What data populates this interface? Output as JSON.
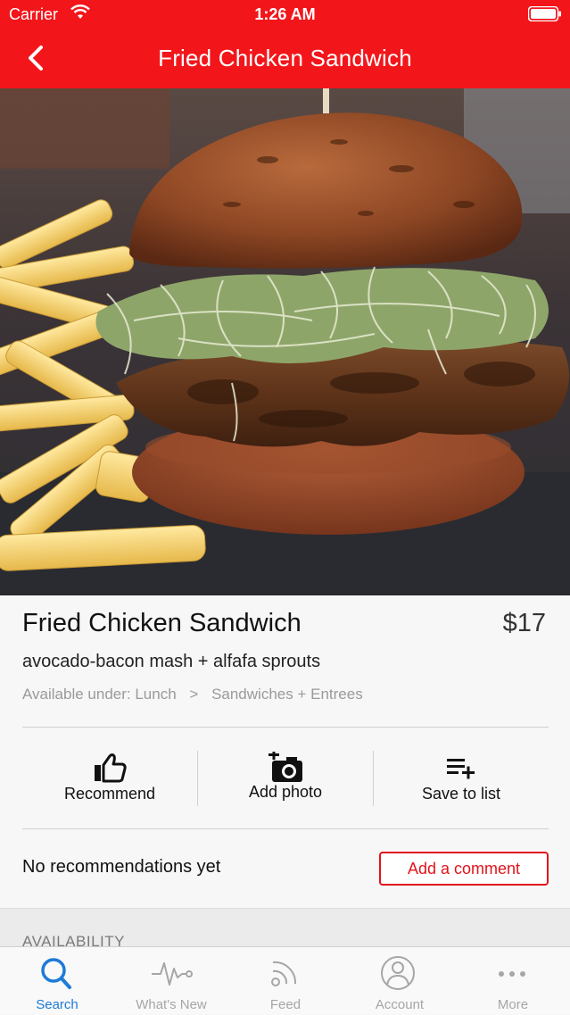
{
  "status_bar": {
    "carrier": "Carrier",
    "time": "1:26 AM"
  },
  "nav": {
    "title": "Fried Chicken Sandwich"
  },
  "dish": {
    "name": "Fried Chicken Sandwich",
    "price": "$17",
    "description": "avocado-bacon mash + alfafa sprouts",
    "availability_prefix": "Available under: Lunch",
    "availability_separator": ">",
    "availability_category": "Sandwiches + Entrees"
  },
  "actions": [
    {
      "label": "Recommend",
      "icon": "thumbs-up-icon"
    },
    {
      "label": "Add photo",
      "icon": "camera-plus-icon"
    },
    {
      "label": "Save to list",
      "icon": "playlist-add-icon"
    }
  ],
  "recommendations": {
    "status": "No recommendations yet",
    "comment_button": "Add a comment"
  },
  "availability_section": {
    "label": "AVAILABILITY"
  },
  "tabs": [
    {
      "label": "Search",
      "icon": "search-icon",
      "active": true
    },
    {
      "label": "What's New",
      "icon": "pulse-icon",
      "active": false
    },
    {
      "label": "Feed",
      "icon": "feed-icon",
      "active": false
    },
    {
      "label": "Account",
      "icon": "account-icon",
      "active": false
    },
    {
      "label": "More",
      "icon": "more-icon",
      "active": false
    }
  ],
  "colors": {
    "brand_red": "#f2161b",
    "active_tab": "#1e7bd6",
    "inactive_tab": "#a6a6a6"
  }
}
